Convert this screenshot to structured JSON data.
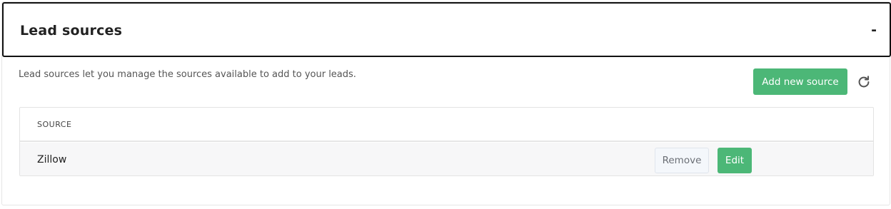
{
  "panel": {
    "title": "Lead sources",
    "collapse_symbol": "-",
    "description": "Lead sources let you manage the sources available to add to your leads."
  },
  "toolbar": {
    "add_label": "Add new source",
    "refresh_icon": "refresh-icon"
  },
  "table": {
    "columns": [
      "SOURCE"
    ],
    "rows": [
      {
        "source": "Zillow",
        "remove_label": "Remove",
        "edit_label": "Edit"
      }
    ]
  },
  "colors": {
    "accent_green": "#4cb777",
    "header_border": "#111111",
    "row_background": "#f7f7f8",
    "remove_background": "#f4f7fb"
  }
}
